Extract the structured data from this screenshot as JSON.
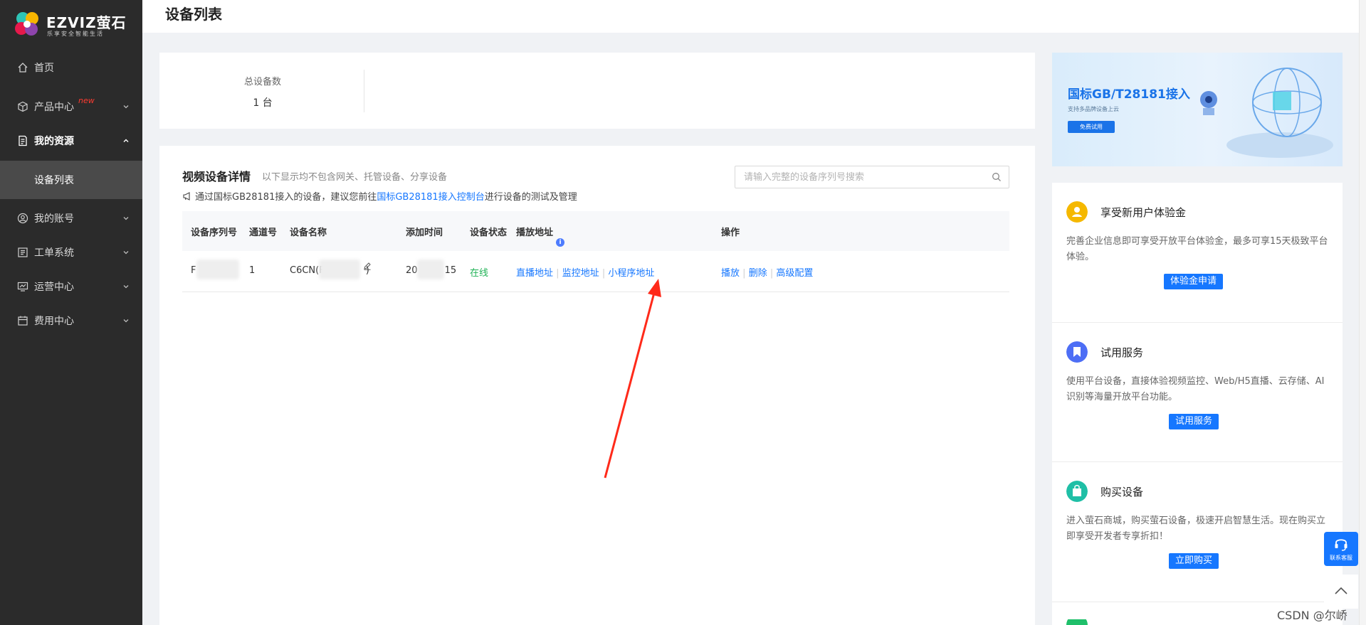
{
  "brand": {
    "name": "EZVIZ萤石",
    "tagline": "乐享安全智能生活"
  },
  "sidebar": {
    "items": [
      {
        "label": "首页"
      },
      {
        "label": "产品中心",
        "badge": "new"
      },
      {
        "label": "我的资源"
      },
      {
        "label": "设备列表"
      },
      {
        "label": "我的账号"
      },
      {
        "label": "工单系统"
      },
      {
        "label": "运营中心"
      },
      {
        "label": "费用中心"
      }
    ]
  },
  "header": {
    "title": "设备列表"
  },
  "stats": {
    "label": "总设备数",
    "value": "1 台"
  },
  "device_section": {
    "title": "视频设备详情",
    "subtitle": "以下显示均不包含网关、托管设备、分享设备",
    "notice_prefix": "通过国标GB28181接入的设备，建议您前往",
    "notice_link": "国标GB28181接入控制台",
    "notice_suffix": "进行设备的测试及管理",
    "search_placeholder": "请输入完整的设备序列号搜索"
  },
  "table": {
    "headers": [
      "设备序列号",
      "通道号",
      "设备名称",
      "添加时间",
      "设备状态",
      "播放地址",
      "操作"
    ],
    "rows": [
      {
        "serial": "F",
        "channel": "1",
        "name_prefix": "C6CN(F",
        "name_suffix": ")",
        "added_prefix": "20",
        "added_suffix": "15",
        "status": "在线",
        "play_links": [
          "直播地址",
          "监控地址",
          "小程序地址"
        ],
        "actions": [
          "播放",
          "删除",
          "高级配置"
        ]
      }
    ]
  },
  "banner": {
    "title": "国标GB/T28181接入",
    "subtitle": "支持多品牌设备上云",
    "button": "免费试用"
  },
  "side_cards": [
    {
      "title": "享受新用户体验金",
      "desc": "完善企业信息即可享受开放平台体验金，最多可享15天极致平台体验。",
      "button": "体验金申请",
      "color": "#f5b800"
    },
    {
      "title": "试用服务",
      "desc": "使用平台设备，直接体验视频监控、Web/H5直播、云存储、AI识别等海量开放平台功能。",
      "button": "试用服务",
      "color": "#4d6ef5"
    },
    {
      "title": "购买设备",
      "desc": "进入萤石商城，购买萤石设备，极速开启智慧生活。现在购买立即享受开发者专享折扣！",
      "button": "立即购买",
      "color": "#1fbfa6"
    }
  ],
  "float": {
    "service_label": "联系客服"
  },
  "watermark": "CSDN @尔峤",
  "colors": {
    "sidebar_bg": "#2b2b2b",
    "accent": "#1677ff",
    "online": "#20b256",
    "annotation_arrow": "#ff2a1a"
  }
}
